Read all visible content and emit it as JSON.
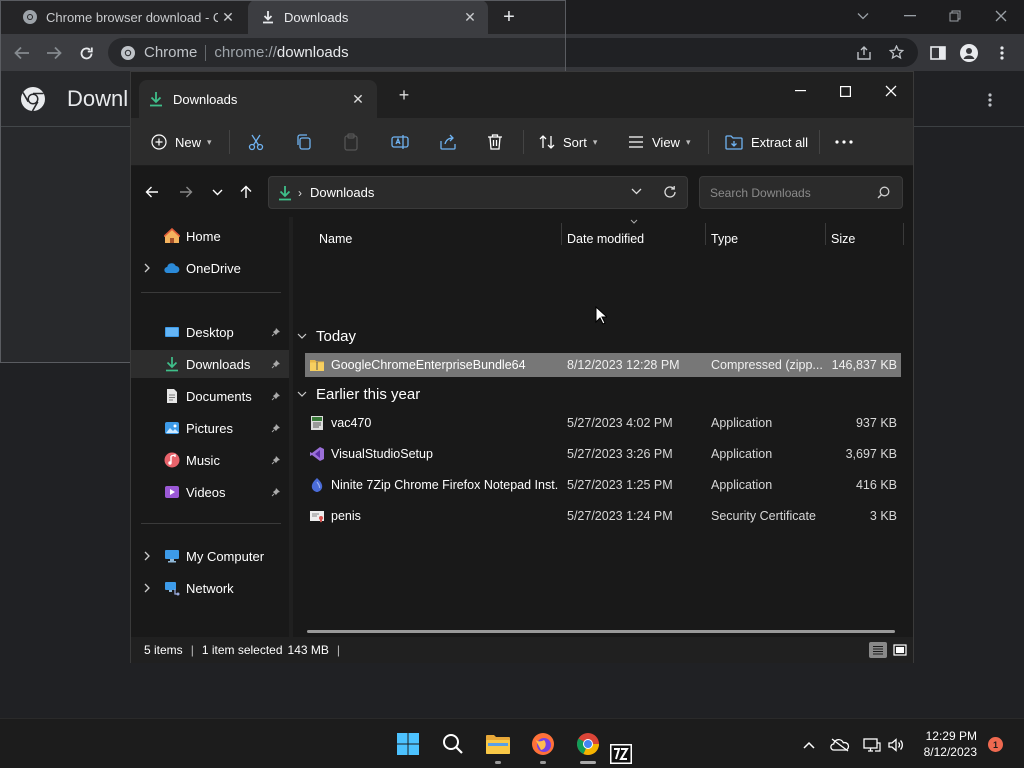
{
  "chrome": {
    "tabs": [
      {
        "title": "Chrome browser download - Chr"
      },
      {
        "title": "Downloads"
      }
    ],
    "omnibox": {
      "site": "Chrome",
      "scheme": "chrome://",
      "path": "downloads"
    },
    "page_title": "Downl"
  },
  "explorer": {
    "tab_title": "Downloads",
    "commands": {
      "new": "New",
      "sort": "Sort",
      "view": "View",
      "extract": "Extract all"
    },
    "address": {
      "crumb": "Downloads",
      "search_placeholder": "Search Downloads"
    },
    "sidebar": {
      "items": [
        {
          "label": "Home"
        },
        {
          "label": "OneDrive"
        },
        {
          "label": "Desktop"
        },
        {
          "label": "Downloads"
        },
        {
          "label": "Documents"
        },
        {
          "label": "Pictures"
        },
        {
          "label": "Music"
        },
        {
          "label": "Videos"
        },
        {
          "label": "My Computer"
        },
        {
          "label": "Network"
        }
      ]
    },
    "columns": {
      "name": "Name",
      "date": "Date modified",
      "type": "Type",
      "size": "Size"
    },
    "groups": {
      "today": "Today",
      "earlier": "Earlier this year"
    },
    "files": [
      {
        "name": "GoogleChromeEnterpriseBundle64",
        "date": "8/12/2023 12:28 PM",
        "type": "Compressed (zipp...",
        "size": "146,837 KB",
        "icon": "zip-folder-icon"
      },
      {
        "name": "vac470",
        "date": "5/27/2023 4:02 PM",
        "type": "Application",
        "size": "937 KB",
        "icon": "installer-icon"
      },
      {
        "name": "VisualStudioSetup",
        "date": "5/27/2023 3:26 PM",
        "type": "Application",
        "size": "3,697 KB",
        "icon": "visual-studio-icon"
      },
      {
        "name": "Ninite 7Zip Chrome Firefox Notepad Inst...",
        "date": "5/27/2023 1:25 PM",
        "type": "Application",
        "size": "416 KB",
        "icon": "ninite-icon"
      },
      {
        "name": "penis",
        "date": "5/27/2023 1:24 PM",
        "type": "Security Certificate",
        "size": "3 KB",
        "icon": "certificate-icon"
      }
    ],
    "status": {
      "count": "5 items",
      "selected": "1 item selected",
      "size": "143 MB"
    }
  },
  "taskbar": {
    "time": "12:29 PM",
    "date": "8/12/2023",
    "notifications": "1"
  },
  "colors": {
    "accent_green": "#3fbf8a",
    "selection": "#777777",
    "notification": "#ef6950"
  }
}
